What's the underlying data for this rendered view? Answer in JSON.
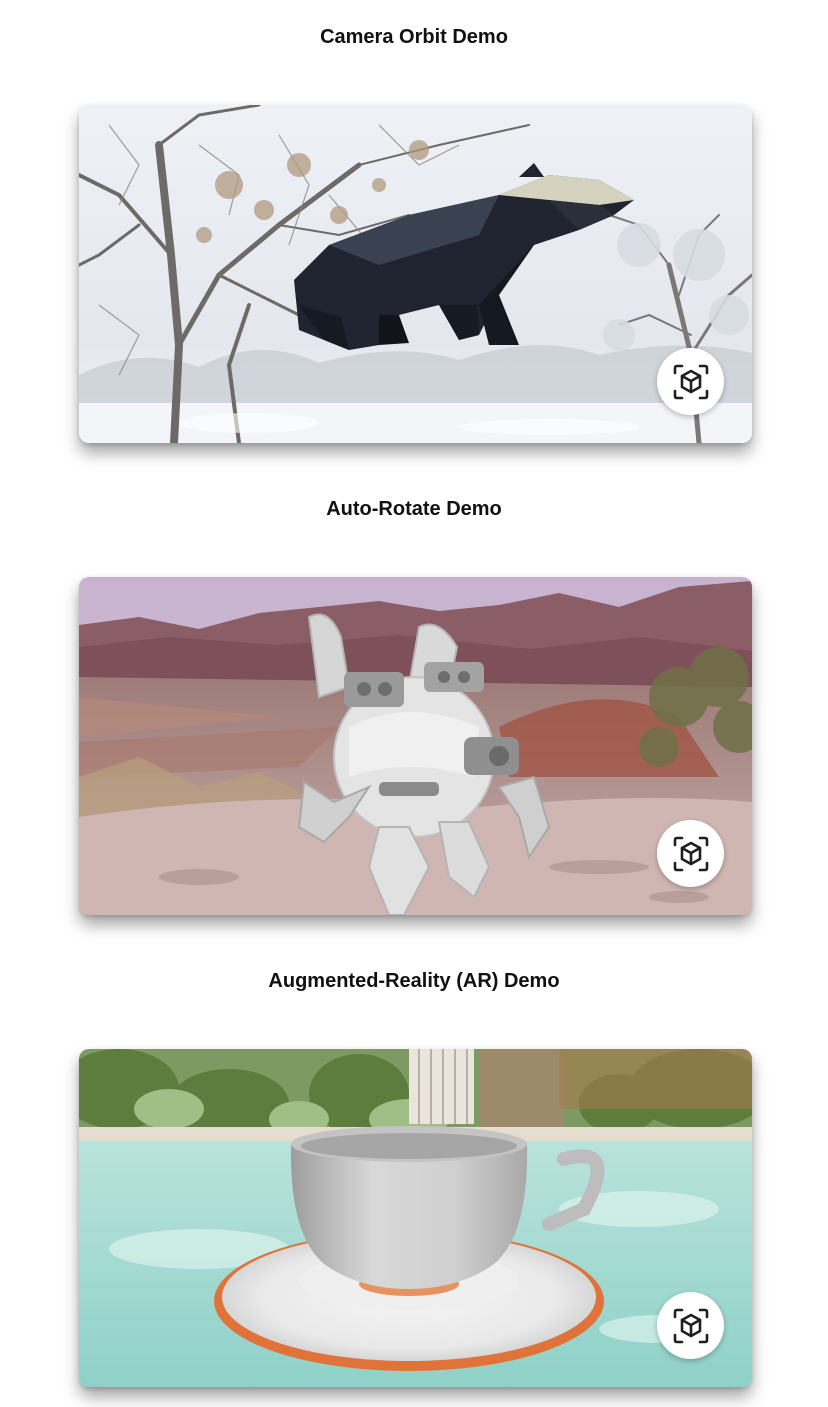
{
  "demos": [
    {
      "title": "Camera Orbit Demo",
      "model": "badger",
      "environment": "snowy-orchard",
      "ar_icon": "ar-cube-icon"
    },
    {
      "title": "Auto-Rotate Demo",
      "model": "robot-drone",
      "environment": "desert-mountains",
      "ar_icon": "ar-cube-icon"
    },
    {
      "title": "Augmented-Reality (AR) Demo",
      "model": "teacup-and-saucer",
      "environment": "pool-garden",
      "ar_icon": "ar-cube-icon"
    }
  ],
  "colors": {
    "title_text": "#111111",
    "card_background": "#ffffff",
    "saucer_rim": "#e0733a"
  }
}
